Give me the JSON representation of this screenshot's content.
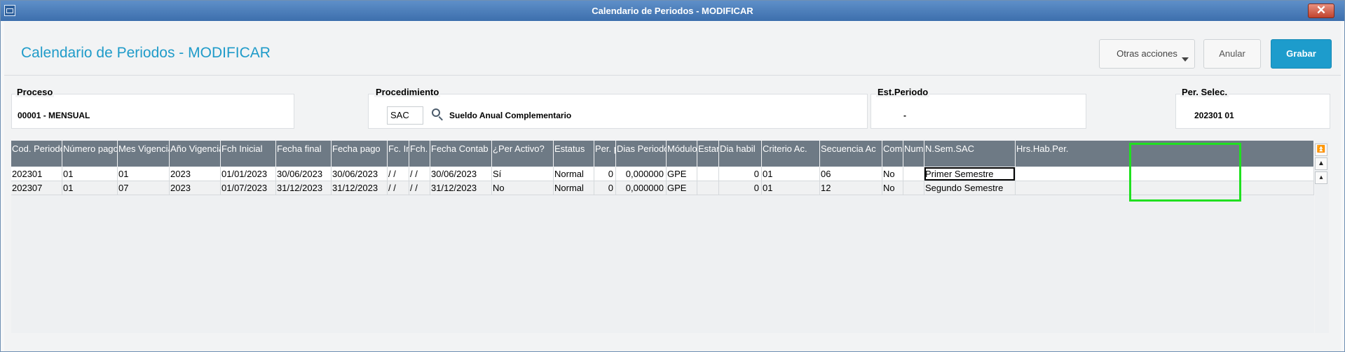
{
  "window": {
    "title": "Calendario de Periodos - MODIFICAR",
    "close_symbol": "✕"
  },
  "header": {
    "page_title": "Calendario de Periodos - MODIFICAR",
    "more_actions_label": "Otras acciones",
    "cancel_label": "Anular",
    "save_label": "Grabar",
    "accent_color": "#1f9bc9"
  },
  "fields": {
    "proceso": {
      "label": "Proceso",
      "value": "00001 - MENSUAL"
    },
    "procedimiento": {
      "label": "Procedimiento",
      "code": "SAC",
      "description": "Sueldo Anual Complementario"
    },
    "est_periodo": {
      "label": "Est.Periodo",
      "value": "-"
    },
    "per_selec": {
      "label": "Per. Selec.",
      "value": "202301 01"
    }
  },
  "grid": {
    "columns": [
      "Cod. Periodo",
      "Número pago",
      "Mes Vigencia",
      "Año Vigencia",
      "Fch Inicial",
      "Fecha final",
      "Fecha pago",
      "Fc. In",
      "Fch. C",
      "Fecha Contab",
      "¿Per Activo?",
      "Estatus",
      "Per. p",
      "Dias Periodo",
      "Módulo",
      "Estan",
      "Dia habil",
      "Criterio Ac.",
      "Secuencia Ac",
      "Comp",
      "Num.",
      "N.Sem.SAC",
      "Hrs.Hab.Per."
    ],
    "rows": [
      [
        "202301",
        "01",
        "01",
        "2023",
        "01/01/2023",
        "30/06/2023",
        "30/06/2023",
        " /  /",
        " /  /",
        "30/06/2023",
        "Sí",
        "Normal",
        "0",
        "0,000000",
        "GPE",
        "",
        "0",
        "01",
        "06",
        "No",
        "",
        "Primer Semestre",
        ""
      ],
      [
        "202307",
        "01",
        "07",
        "2023",
        "01/07/2023",
        "31/12/2023",
        "31/12/2023",
        " /  /",
        " /  /",
        "31/12/2023",
        "No",
        "Normal",
        "0",
        "0,000000",
        "GPE",
        "",
        "0",
        "01",
        "12",
        "No",
        "",
        "Segundo Semestre",
        ""
      ]
    ],
    "highlight_color": "#20e020"
  },
  "scrollbar": {
    "top_symbol": "⏫",
    "page_up_symbol": "▲",
    "up_symbol": "▴"
  }
}
